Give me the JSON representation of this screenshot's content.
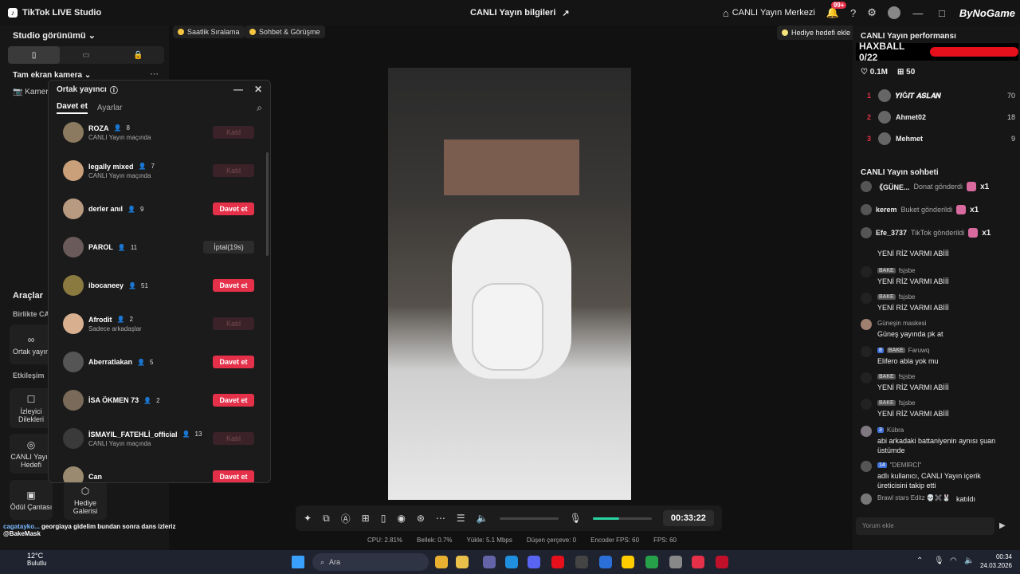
{
  "titlebar": {
    "app_title": "TikTok LIVE Studio",
    "live_info": "CANLI Yayın bilgileri",
    "live_center": "CANLI Yayın Merkezi",
    "notif_count": "99+",
    "brand": "ByNoGame"
  },
  "left": {
    "studio_view": "Studio görünümü",
    "full_camera": "Tam ekran kamera",
    "camera_label": "Kamer",
    "tools_title": "Araçlar",
    "together_label": "Birlikte CAN",
    "cohost_tool": "Ortak yayın",
    "interaction_label": "Etkileşim",
    "viewer_requests": "İzleyici Dilekleri",
    "live_goal": "CANLI Yayın Hedefi",
    "reward_bag": "Ödül Çantası",
    "gift_gallery": "Hediye Galerisi"
  },
  "chips": {
    "hourly_rank": "Saatlik Sıralama",
    "chat_meet": "Sohbet & Görüşme",
    "add_gift_goal": "Hediye hedefi ekle"
  },
  "modal": {
    "title": "Ortak yayıncı",
    "tab_invite": "Davet et",
    "tab_settings": "Ayarlar",
    "rows": [
      {
        "name": "ROZA",
        "count": "8",
        "sub": "CANLI Yayın maçında",
        "action": "Katıl",
        "type": "join",
        "color": "#8c7a60"
      },
      {
        "name": "legally mixed",
        "count": "7",
        "sub": "CANLI Yayın maçında",
        "action": "Katıl",
        "type": "join",
        "color": "#c9a07a"
      },
      {
        "name": "derler anıl",
        "count": "9",
        "sub": "",
        "action": "Davet et",
        "type": "invite",
        "color": "#b89a80"
      },
      {
        "name": "PAROL",
        "count": "11",
        "sub": "",
        "action": "İptal(19s)",
        "type": "cancel",
        "color": "#6a5a5a"
      },
      {
        "name": "ibocaneey",
        "count": "51",
        "sub": "",
        "action": "Davet et",
        "type": "invite",
        "color": "#8a7a40"
      },
      {
        "name": "Afrodit",
        "count": "2",
        "sub": "Sadece arkadaşlar",
        "action": "Katıl",
        "type": "join",
        "color": "#d8b090"
      },
      {
        "name": "Aberratlakan",
        "count": "5",
        "sub": "",
        "action": "Davet et",
        "type": "invite",
        "color": "#555555"
      },
      {
        "name": "İSA ÖKMEN 73",
        "count": "2",
        "sub": "",
        "action": "Davet et",
        "type": "invite",
        "color": "#7a6a5a"
      },
      {
        "name": "İSMAYIL_FATEHLİ_official",
        "count": "13",
        "sub": "CANLI Yayın maçında",
        "action": "Katıl",
        "type": "join",
        "color": "#3a3a3a"
      },
      {
        "name": "Can",
        "count": "",
        "sub": "",
        "action": "Davet et",
        "type": "invite",
        "color": "#9a8a70"
      }
    ]
  },
  "controls": {
    "timer": "00:33:22",
    "mic_level": 0.45,
    "volume_level": 0.0
  },
  "stats": {
    "cpu": "CPU: 2.81%",
    "memory": "Bellek: 0.7%",
    "upload": "Yükle: 5.1 Mbps",
    "dropped": "Düşen çerçeve: 0",
    "encoder_fps": "Encoder FPS: 60",
    "fps": "FPS: 60"
  },
  "right": {
    "perf_title": "CANLI Yayın performansı",
    "haxball": "HAXBALL 0/22",
    "likes": "0.1M",
    "gifts": "50",
    "ranks": [
      {
        "n": "1",
        "name": "𝒀𝑰Ğ𝑰𝑻 𝑨𝑺𝑳𝑨𝑵",
        "v": "70"
      },
      {
        "n": "2",
        "name": "Ahmet02",
        "v": "18"
      },
      {
        "n": "3",
        "name": "Mehmet",
        "v": "9"
      }
    ],
    "chat_title": "CANLI Yayın sohbeti",
    "gifts_list": [
      {
        "user": "《GÜNE...",
        "text": "Donat gönderdi",
        "x": "x1"
      },
      {
        "user": "kerem",
        "text": "Buket gönderildi",
        "x": "x1"
      },
      {
        "user": "Efe_3737",
        "text": "TikTok gönderildi",
        "x": "x1"
      }
    ],
    "messages": [
      {
        "name": "",
        "tags": [],
        "text": "YENİ RİZ VARMI ABİİİ"
      },
      {
        "name": "fsjsbe",
        "tags": [
          "BAKE"
        ],
        "text": "YENİ RİZ VARMI ABİİİ"
      },
      {
        "name": "fsjsbe",
        "tags": [
          "BAKE"
        ],
        "text": "YENİ RİZ VARMI ABİİİ"
      },
      {
        "name": "Güneşin maskesi",
        "tags": [],
        "text": "Güneş yayında pk at"
      },
      {
        "name": "Faruwq",
        "tags": [
          "8",
          "BAKE"
        ],
        "text": "Elifero abla yok mu"
      },
      {
        "name": "fsjsbe",
        "tags": [
          "BAKE"
        ],
        "text": "YENİ RİZ VARMI ABİİİ"
      },
      {
        "name": "fsjsbe",
        "tags": [
          "BAKE"
        ],
        "text": "YENİ RİZ VARMI ABİİİ"
      },
      {
        "name": "Kübra",
        "tags": [
          "3"
        ],
        "text": "abi arkadaki battaniyenin aynısı şuan üstümde"
      },
      {
        "name": "\"DEMİRCİ\"",
        "tags": [
          "14"
        ],
        "text": "adlı kullanıcı, CANLI Yayın içerik üreticisini takip etti"
      },
      {
        "name": "Brawl stars Editz 💀✖️🐰",
        "tags": [],
        "text": "katıldı"
      }
    ],
    "comment_placeholder": "Yorum ekle"
  },
  "overlay": {
    "user": "cagatayko...",
    "text": "georgiaya gidelim bundan sonra dans izleriz",
    "mention": "@BakeMask"
  },
  "taskbar": {
    "temp": "12°C",
    "weather": "Bulutlu",
    "search": "Ara",
    "time": "00:34",
    "date": "24.03.2026"
  }
}
